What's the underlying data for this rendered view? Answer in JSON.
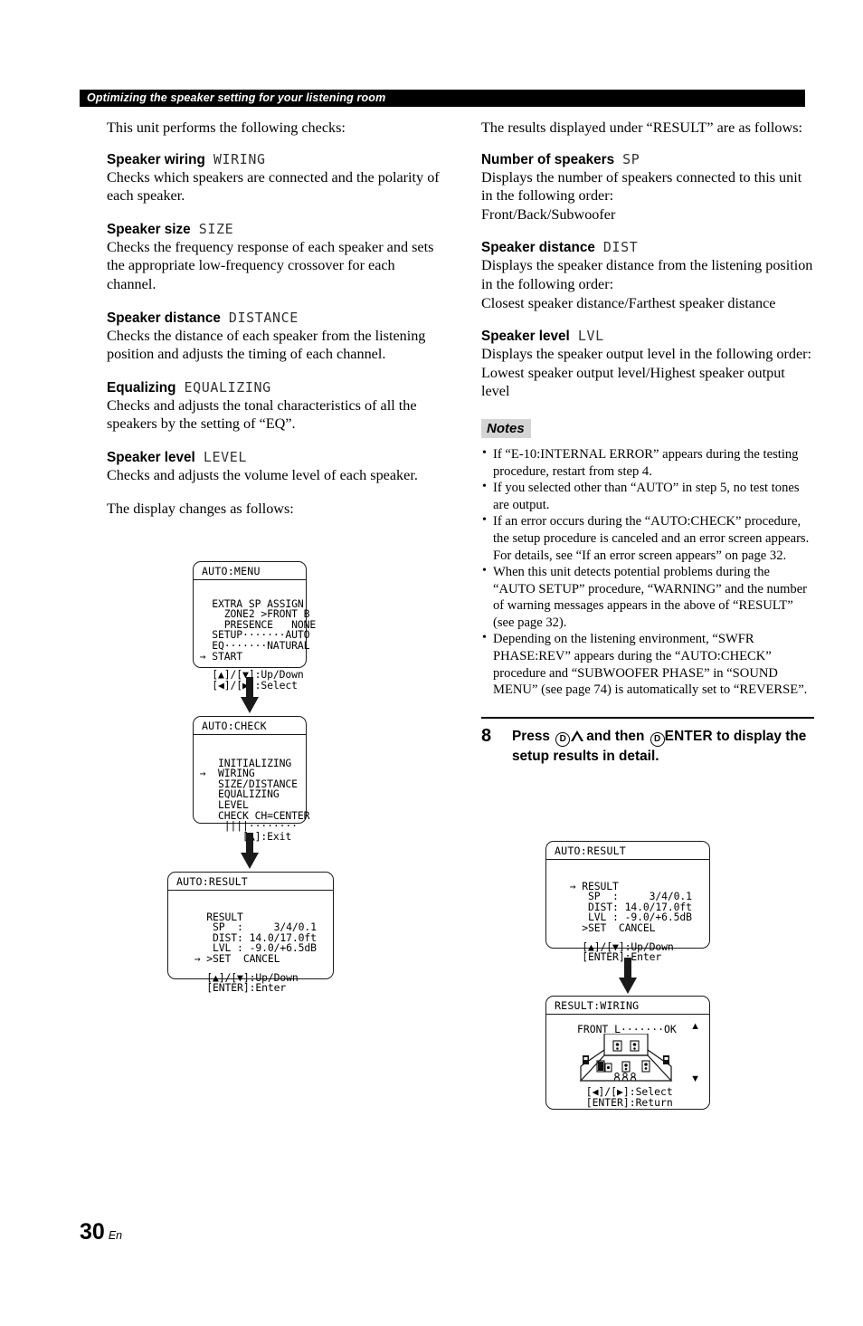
{
  "header": {
    "running_head": "Optimizing the speaker setting for your listening room"
  },
  "footer": {
    "page_number": "30",
    "language": "En"
  },
  "left_column": {
    "intro": "This unit performs the following checks:",
    "sections": [
      {
        "title": "Speaker wiring",
        "code": "WIRING",
        "body": "Checks which speakers are connected and the polarity of each speaker."
      },
      {
        "title": "Speaker size",
        "code": "SIZE",
        "body": "Checks the frequency response of each speaker and sets the appropriate low-frequency crossover for each channel."
      },
      {
        "title": "Speaker distance",
        "code": "DISTANCE",
        "body": "Checks the distance of each speaker from the listening position and adjusts the timing of each channel."
      },
      {
        "title": "Equalizing",
        "code": "EQUALIZING",
        "body": "Checks and adjusts the tonal characteristics of all the speakers by the setting of “EQ”."
      },
      {
        "title": "Speaker level",
        "code": "LEVEL",
        "body": "Checks and adjusts the volume level of each speaker."
      }
    ],
    "display_intro": "The display changes as follows:"
  },
  "right_column": {
    "intro": "The results displayed under “RESULT” are as follows:",
    "sections": [
      {
        "title": "Number of speakers",
        "code": "SP",
        "body": "Displays the number of speakers connected to this unit in the following order:",
        "body2": "Front/Back/Subwoofer"
      },
      {
        "title": "Speaker distance",
        "code": "DIST",
        "body": "Displays the speaker distance from the listening position in the following order:",
        "body2": "Closest speaker distance/Farthest speaker distance"
      },
      {
        "title": "Speaker level",
        "code": "LVL",
        "body": "Displays the speaker output level in the following order:",
        "body2": "Lowest speaker output level/Highest speaker output level"
      }
    ],
    "notes_label": "Notes",
    "notes": [
      "If “E-10:INTERNAL ERROR” appears during the testing procedure, restart from step 4.",
      "If you selected other than “AUTO” in step 5, no test tones are output.",
      "If an error occurs during the “AUTO:CHECK” procedure, the setup procedure is canceled and an error screen appears. For details, see “If an error screen appears” on page 32.",
      "When this unit detects potential problems during the “AUTO SETUP” procedure, “WARNING” and the number of warning messages appears in the above of “RESULT” (see page 32).",
      "Depending on the listening environment, “SWFR PHASE:REV” appears during the “AUTO:CHECK” procedure and “SUBWOOFER PHASE” in “SOUND MENU” (see page 74) is automatically set to “REVERSE”."
    ],
    "step": {
      "number": "8",
      "text_part1": "Press",
      "button1_badge": "D",
      "button1_glyph": "up-triangle",
      "text_part2": "and then",
      "button2_badge": "D",
      "button2_label": "ENTER",
      "text_part3": "to display the setup results in detail."
    }
  },
  "lcd_screens": [
    {
      "id": "auto-menu",
      "title": "AUTO:MENU",
      "lines": [
        "   EXTRA SP ASSIGN",
        "     ZONE2 >FRONT B",
        "     PRESENCE   NONE",
        "   SETUP·······AUTO",
        "   EQ·······NATURAL",
        " → START"
      ],
      "footer_lines": [
        "   [▲]/[▼]:Up/Down",
        "   [◀]/[▶]:Select"
      ]
    },
    {
      "id": "auto-check",
      "title": "AUTO:CHECK",
      "lines": [
        "    INITIALIZING",
        " →  WIRING",
        "    SIZE/DISTANCE",
        "    EQUALIZING",
        "    LEVEL",
        "    CHECK CH=CENTER",
        "     ||||········",
        "        [▲]:Exit"
      ],
      "footer_lines": []
    },
    {
      "id": "auto-result-left",
      "title": "AUTO:RESULT",
      "lines": [
        "   RESULT",
        "    SP  :     3/4/0.1",
        "    DIST: 14.0/17.0ft",
        "    LVL : -9.0/+6.5dB",
        " → >SET  CANCEL"
      ],
      "footer_lines": [
        "   [▲]/[▼]:Up/Down",
        "   [ENTER]:Enter"
      ]
    },
    {
      "id": "auto-result-right",
      "title": "AUTO:RESULT",
      "lines": [
        " → RESULT",
        "    SP  :     3/4/0.1",
        "    DIST: 14.0/17.0ft",
        "    LVL : -9.0/+6.5dB",
        "   >SET  CANCEL"
      ],
      "footer_lines": [
        "   [▲]/[▼]:Up/Down",
        "   [ENTER]:Enter"
      ]
    },
    {
      "id": "result-wiring",
      "title": "RESULT:WIRING",
      "status_line": "FRONT L·······OK",
      "scroll_up": "▲",
      "scroll_down": "▼",
      "footer_lines": [
        "  [◀]/[▶]:Select",
        "  [ENTER]:Return"
      ]
    }
  ]
}
